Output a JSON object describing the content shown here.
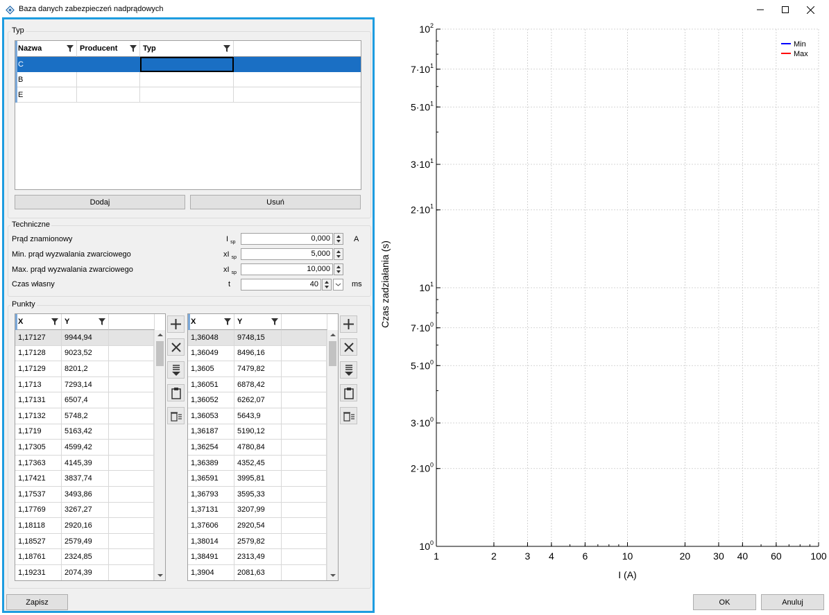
{
  "window": {
    "title": "Baza danych zabezpieczeń nadprądowych"
  },
  "typ_group": {
    "label": "Typ",
    "columns": [
      "Nazwa",
      "Producent",
      "Typ"
    ],
    "rows": [
      {
        "nazwa": "C",
        "producent": "",
        "typ": ""
      },
      {
        "nazwa": "B",
        "producent": "",
        "typ": ""
      },
      {
        "nazwa": "E",
        "producent": "",
        "typ": ""
      }
    ],
    "add_label": "Dodaj",
    "remove_label": "Usuń"
  },
  "techniczne": {
    "label": "Techniczne",
    "fields": [
      {
        "label": "Prąd znamionowy",
        "symbol": "I",
        "symbol_sub": "sp",
        "value": "0,000",
        "unit": "A"
      },
      {
        "label": "Min. prąd wyzwalania zwarciowego",
        "symbol": "xI",
        "symbol_sub": "sp",
        "value": "5,000",
        "unit": ""
      },
      {
        "label": "Max. prąd wyzwalania zwarciowego",
        "symbol": "xI",
        "symbol_sub": "sp",
        "value": "10,000",
        "unit": ""
      },
      {
        "label": "Czas własny",
        "symbol": "t",
        "symbol_sub": "",
        "value": "40",
        "unit": "ms"
      }
    ]
  },
  "punkty": {
    "label": "Punkty",
    "columns": [
      "X",
      "Y"
    ],
    "min_points": [
      [
        "1,17127",
        "9944,94"
      ],
      [
        "1,17128",
        "9023,52"
      ],
      [
        "1,17129",
        "8201,2"
      ],
      [
        "1,1713",
        "7293,14"
      ],
      [
        "1,17131",
        "6507,4"
      ],
      [
        "1,17132",
        "5748,2"
      ],
      [
        "1,1719",
        "5163,42"
      ],
      [
        "1,17305",
        "4599,42"
      ],
      [
        "1,17363",
        "4145,39"
      ],
      [
        "1,17421",
        "3837,74"
      ],
      [
        "1,17537",
        "3493,86"
      ],
      [
        "1,17769",
        "3267,27"
      ],
      [
        "1,18118",
        "2920,16"
      ],
      [
        "1,18527",
        "2579,49"
      ],
      [
        "1,18761",
        "2324,85"
      ],
      [
        "1,19231",
        "2074,39"
      ]
    ],
    "max_points": [
      [
        "1,36048",
        "9748,15"
      ],
      [
        "1,36049",
        "8496,16"
      ],
      [
        "1,3605",
        "7479,82"
      ],
      [
        "1,36051",
        "6878,42"
      ],
      [
        "1,36052",
        "6262,07"
      ],
      [
        "1,36053",
        "5643,9"
      ],
      [
        "1,36187",
        "5190,12"
      ],
      [
        "1,36254",
        "4780,84"
      ],
      [
        "1,36389",
        "4352,45"
      ],
      [
        "1,36591",
        "3995,81"
      ],
      [
        "1,36793",
        "3595,33"
      ],
      [
        "1,37131",
        "3207,99"
      ],
      [
        "1,37606",
        "2920,54"
      ],
      [
        "1,38014",
        "2579,82"
      ],
      [
        "1,38491",
        "2313,49"
      ],
      [
        "1,3904",
        "2081,63"
      ]
    ]
  },
  "buttons": {
    "save": "Zapisz",
    "ok": "OK",
    "cancel": "Anuluj"
  },
  "chart_data": {
    "type": "line",
    "xlabel": "I (A)",
    "ylabel": "Czas zadziałania (s)",
    "x_scale": "log",
    "y_scale": "log",
    "xlim": [
      1,
      100
    ],
    "ylim": [
      1,
      100
    ],
    "x_ticks": [
      "1",
      "2",
      "3",
      "4",
      "6",
      "10",
      "20",
      "30",
      "40",
      "60",
      "100"
    ],
    "x_tick_values": [
      1,
      2,
      3,
      4,
      6,
      10,
      20,
      30,
      40,
      60,
      100
    ],
    "y_ticks": [
      {
        "mant": "",
        "exp": "0",
        "base": "10",
        "value": 1
      },
      {
        "mant": "2·",
        "exp": "0",
        "base": "10",
        "value": 2
      },
      {
        "mant": "3·",
        "exp": "0",
        "base": "10",
        "value": 3
      },
      {
        "mant": "5·",
        "exp": "0",
        "base": "10",
        "value": 5
      },
      {
        "mant": "7·",
        "exp": "0",
        "base": "10",
        "value": 7
      },
      {
        "mant": "",
        "exp": "1",
        "base": "10",
        "value": 10
      },
      {
        "mant": "2·",
        "exp": "1",
        "base": "10",
        "value": 20
      },
      {
        "mant": "3·",
        "exp": "1",
        "base": "10",
        "value": 30
      },
      {
        "mant": "5·",
        "exp": "1",
        "base": "10",
        "value": 50
      },
      {
        "mant": "7·",
        "exp": "1",
        "base": "10",
        "value": 70
      },
      {
        "mant": "",
        "exp": "2",
        "base": "10",
        "value": 100
      }
    ],
    "grid": true,
    "legend_position": "top-right",
    "series": [
      {
        "name": "Min",
        "color": "#0000ff",
        "values": []
      },
      {
        "name": "Max",
        "color": "#ff0000",
        "values": []
      }
    ]
  }
}
